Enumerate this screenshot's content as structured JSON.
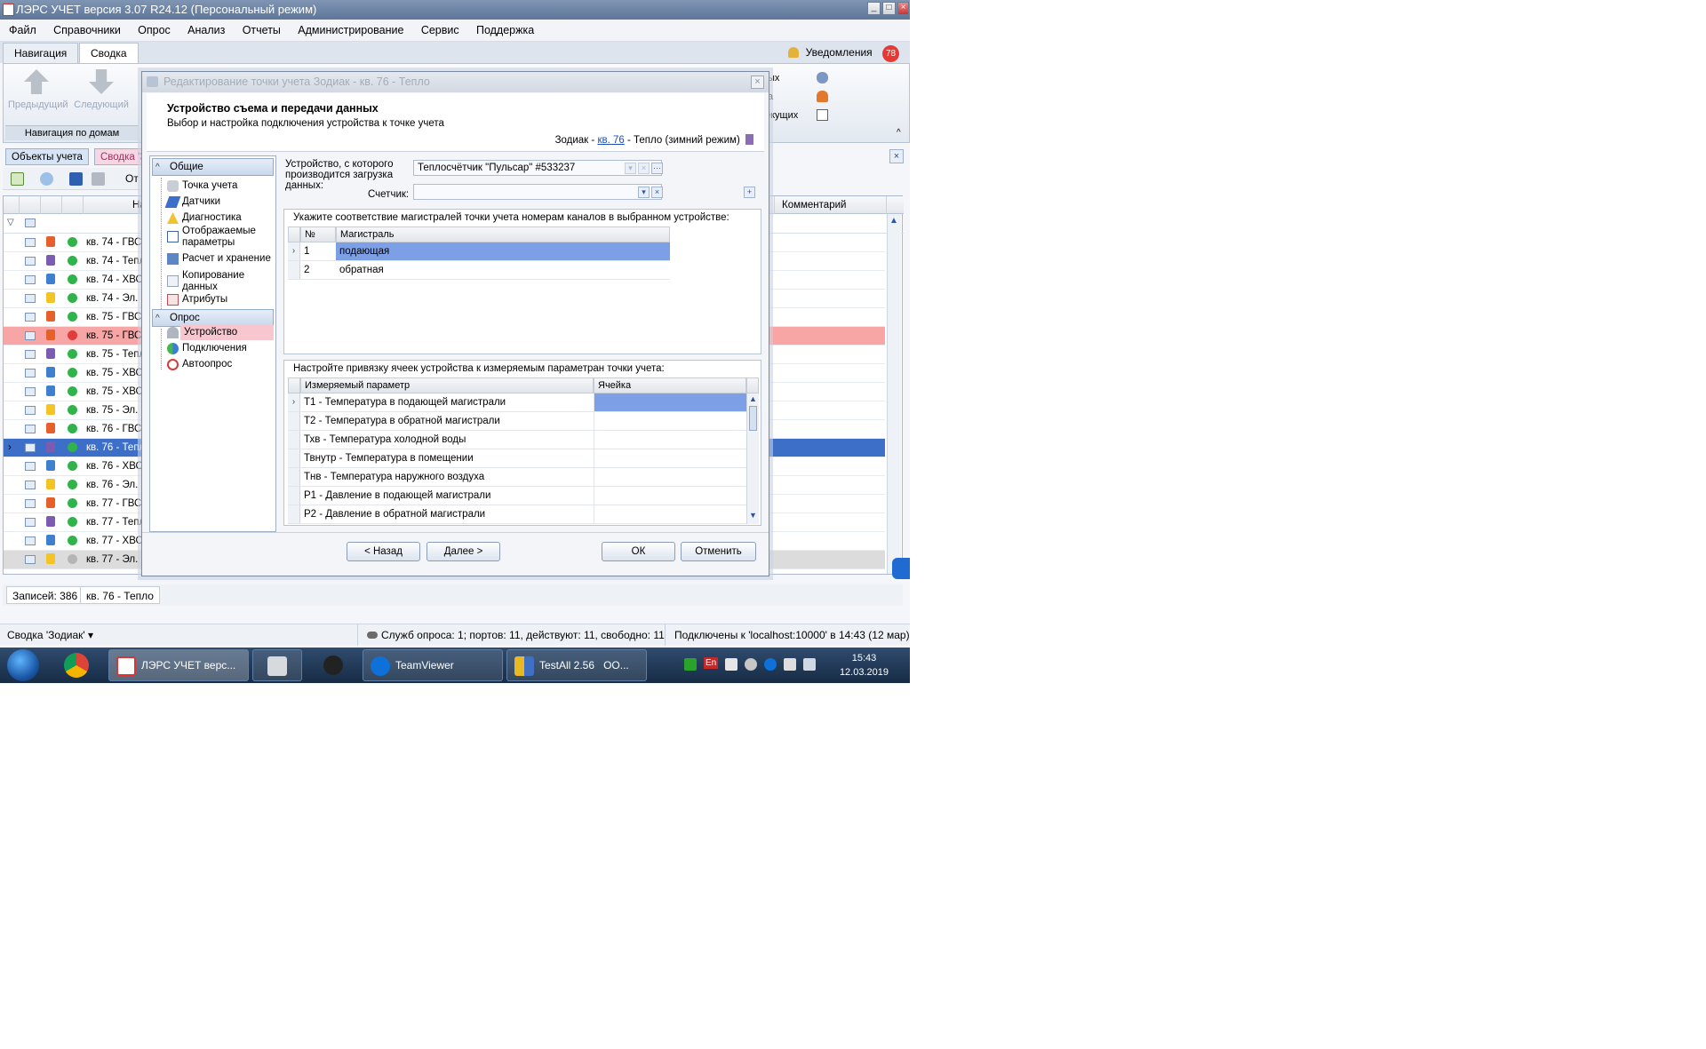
{
  "window": {
    "title": "ЛЭРС УЧЕТ версия 3.07 R24.12 (Персональный режим)"
  },
  "menu": [
    "Файл",
    "Справочники",
    "Опрос",
    "Анализ",
    "Отчеты",
    "Администрирование",
    "Сервис",
    "Поддержка"
  ],
  "ribbon_tabs": [
    "Навигация",
    "Сводка"
  ],
  "notifications": {
    "label": "Уведомления",
    "count": "78"
  },
  "ribbon": {
    "prev": "Предыдущий",
    "next": "Следующий",
    "group_label": "Навигация по домам",
    "right_items": [
      "ых",
      "а",
      "екущих"
    ]
  },
  "doc_tabs": [
    "Объекты учета",
    "Сводка 'З"
  ],
  "toolbar": {
    "report_label": "От"
  },
  "grid": {
    "header_name": "На",
    "header_comment": "Комментарий",
    "rows": [
      {
        "name": "кв. 74 - ГВС",
        "type": "hot",
        "status": "ok"
      },
      {
        "name": "кв. 74 - Тепл",
        "type": "heat",
        "status": "ok"
      },
      {
        "name": "кв. 74 - ХВС",
        "type": "cold",
        "status": "ok"
      },
      {
        "name": "кв. 74 - Эл.",
        "type": "el",
        "status": "ok"
      },
      {
        "name": "кв. 75 - ГВС",
        "type": "hot",
        "status": "ok"
      },
      {
        "name": "кв. 75 - ГВС",
        "type": "hot",
        "status": "error"
      },
      {
        "name": "кв. 75 - Тепл",
        "type": "heat",
        "status": "ok"
      },
      {
        "name": "кв. 75 - ХВС",
        "type": "cold",
        "status": "ok"
      },
      {
        "name": "кв. 75 - ХВС",
        "type": "cold",
        "status": "ok"
      },
      {
        "name": "кв. 75 - Эл.",
        "type": "el",
        "status": "ok"
      },
      {
        "name": "кв. 76 - ГВС",
        "type": "hot",
        "status": "ok"
      },
      {
        "name": "кв. 76 - Тепл",
        "type": "heat",
        "status": "ok"
      },
      {
        "name": "кв. 76 - ХВС",
        "type": "cold",
        "status": "ok"
      },
      {
        "name": "кв. 76 - Эл.",
        "type": "el",
        "status": "ok"
      },
      {
        "name": "кв. 77 - ГВС",
        "type": "hot",
        "status": "ok"
      },
      {
        "name": "кв. 77 - Тепл",
        "type": "heat",
        "status": "ok"
      },
      {
        "name": "кв. 77 - ХВС",
        "type": "cold",
        "status": "ok"
      },
      {
        "name": "кв. 77 - Эл.",
        "type": "el",
        "status": "off"
      }
    ]
  },
  "statusbar": {
    "records": "Записей: 386",
    "current": "кв. 76 - Тепло",
    "summary": "Сводка 'Зодиак'",
    "service": "Служб опроса: 1; портов: 11, действуют: 11, свободно: 11",
    "connection": "Подключены к 'localhost:10000' в 14:43 (12 мар)"
  },
  "taskbar": {
    "items": [
      "ЛЭРС УЧЕТ верс...",
      "TeamViewer",
      "TestAll 2.56",
      "ОО..."
    ],
    "lang": "En",
    "time": "15:43",
    "date": "12.03.2019"
  },
  "dialog": {
    "title": "Редактирование точки учета Зодиак - кв. 76 - Тепло",
    "header_title": "Устройство съема и передачи данных",
    "header_sub": "Выбор и настройка подключения устройства к точке учета",
    "crumb_prefix": "Зодиак -",
    "crumb_link": "кв. 76",
    "crumb_suffix": "- Тепло (зимний режим)",
    "nav": {
      "group1": "Общие",
      "items1": [
        "Точка учета",
        "Датчики",
        "Диагностика",
        "Отображаемые параметры",
        "Расчет и хранение",
        "Копирование данных",
        "Атрибуты"
      ],
      "group2": "Опрос",
      "items2": [
        "Устройство",
        "Подключения",
        "Автоопрос"
      ]
    },
    "device_label": "Устройство, с которого производится загрузка данных:",
    "device_value": "Теплосчётчик \"Пульсар\" #533237",
    "counter_label": "Счетчик:",
    "counter_value": "",
    "channels": {
      "title": "Укажите соответствие магистралей точки учета номерам каналов в выбранном устройстве:",
      "col_no": "№",
      "col_main": "Магистраль",
      "rows": [
        {
          "no": "1",
          "main": "подающая"
        },
        {
          "no": "2",
          "main": "обратная"
        }
      ]
    },
    "cells": {
      "title": "Настройте привязку ячеек устройства к измеряемым параметран точки учета:",
      "col_param": "Измеряемый параметр",
      "col_cell": "Ячейка",
      "rows": [
        "T1 - Температура в подающей магистрали",
        "T2 - Температура в обратной магистрали",
        "Тхв - Температура холодной воды",
        "Твнутр - Температура в помещении",
        "Тнв - Температура наружного воздуха",
        "P1 - Давление в подающей магистрали",
        "P2 - Давление в обратной магистрали"
      ]
    },
    "buttons": {
      "back": "< Назад",
      "next": "Далее >",
      "ok": "ОК",
      "cancel": "Отменить"
    }
  }
}
